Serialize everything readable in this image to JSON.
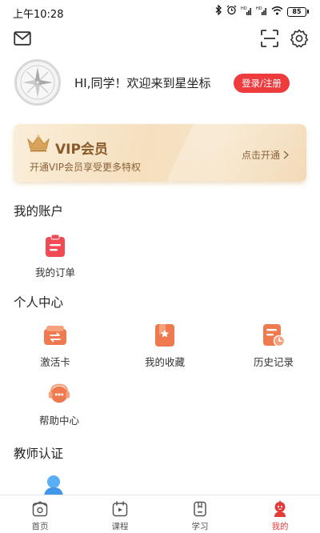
{
  "status_bar": {
    "time": "上午10:28",
    "battery": "85"
  },
  "profile": {
    "greeting": "HI,同学！欢迎来到星坐标",
    "login_label": "登录/注册"
  },
  "vip": {
    "title": "VIP会员",
    "subtitle": "开通VIP会员享受更多特权",
    "cta": "点击开通"
  },
  "sections": {
    "account": {
      "title": "我的账户",
      "items": [
        {
          "label": "我的订单",
          "icon": "order-icon"
        }
      ]
    },
    "personal": {
      "title": "个人中心",
      "items": [
        {
          "label": "激活卡",
          "icon": "activation-card-icon"
        },
        {
          "label": "我的收藏",
          "icon": "favorites-icon"
        },
        {
          "label": "历史记录",
          "icon": "history-icon"
        },
        {
          "label": "帮助中心",
          "icon": "help-center-icon"
        }
      ]
    },
    "teacher": {
      "title": "教师认证"
    }
  },
  "bottom_nav": [
    {
      "label": "首页",
      "icon": "home-icon"
    },
    {
      "label": "课程",
      "icon": "course-icon"
    },
    {
      "label": "学习",
      "icon": "study-icon"
    },
    {
      "label": "我的",
      "icon": "profile-icon",
      "active": true
    }
  ],
  "colors": {
    "accent_red": "#ee3b3e",
    "icon_orange": "#f07a4f",
    "vip_gold": "#8a5a2b"
  }
}
